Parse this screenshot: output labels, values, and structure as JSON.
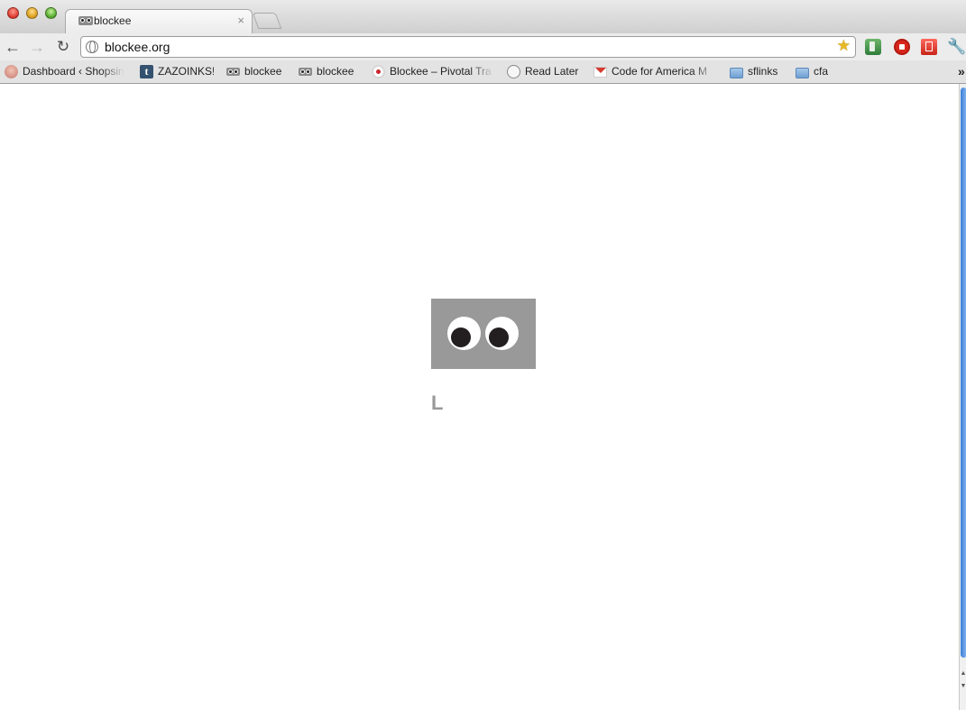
{
  "window": {
    "tab": {
      "title": "blockee",
      "close_glyph": "×"
    }
  },
  "toolbar": {
    "back_glyph": "←",
    "forward_glyph": "→",
    "reload_glyph": "↻",
    "url": "blockee.org",
    "star_glyph": "★",
    "wrench_glyph": "🔧"
  },
  "bookmarks": [
    {
      "label": "Dashboard ‹ Shopsin",
      "icon": "avatar-icon"
    },
    {
      "label": "ZAZOINKS!",
      "icon": "tumblr-icon",
      "icon_text": "t"
    },
    {
      "label": "blockee",
      "icon": "blockee-eyes-icon"
    },
    {
      "label": "blockee",
      "icon": "blockee-eyes-icon"
    },
    {
      "label": "Blockee – Pivotal Tra",
      "icon": "pivotal-icon"
    },
    {
      "label": "Read Later",
      "icon": "globe-icon"
    },
    {
      "label": "Code for America M",
      "icon": "gmail-icon"
    },
    {
      "label": "sflinks",
      "icon": "folder-icon"
    },
    {
      "label": "cfa",
      "icon": "folder-icon"
    }
  ],
  "bookmarks_overflow": "»",
  "page": {
    "logo_icon": "googly-eyes-logo",
    "logo_bg": "#999999",
    "typed_text": "L"
  }
}
